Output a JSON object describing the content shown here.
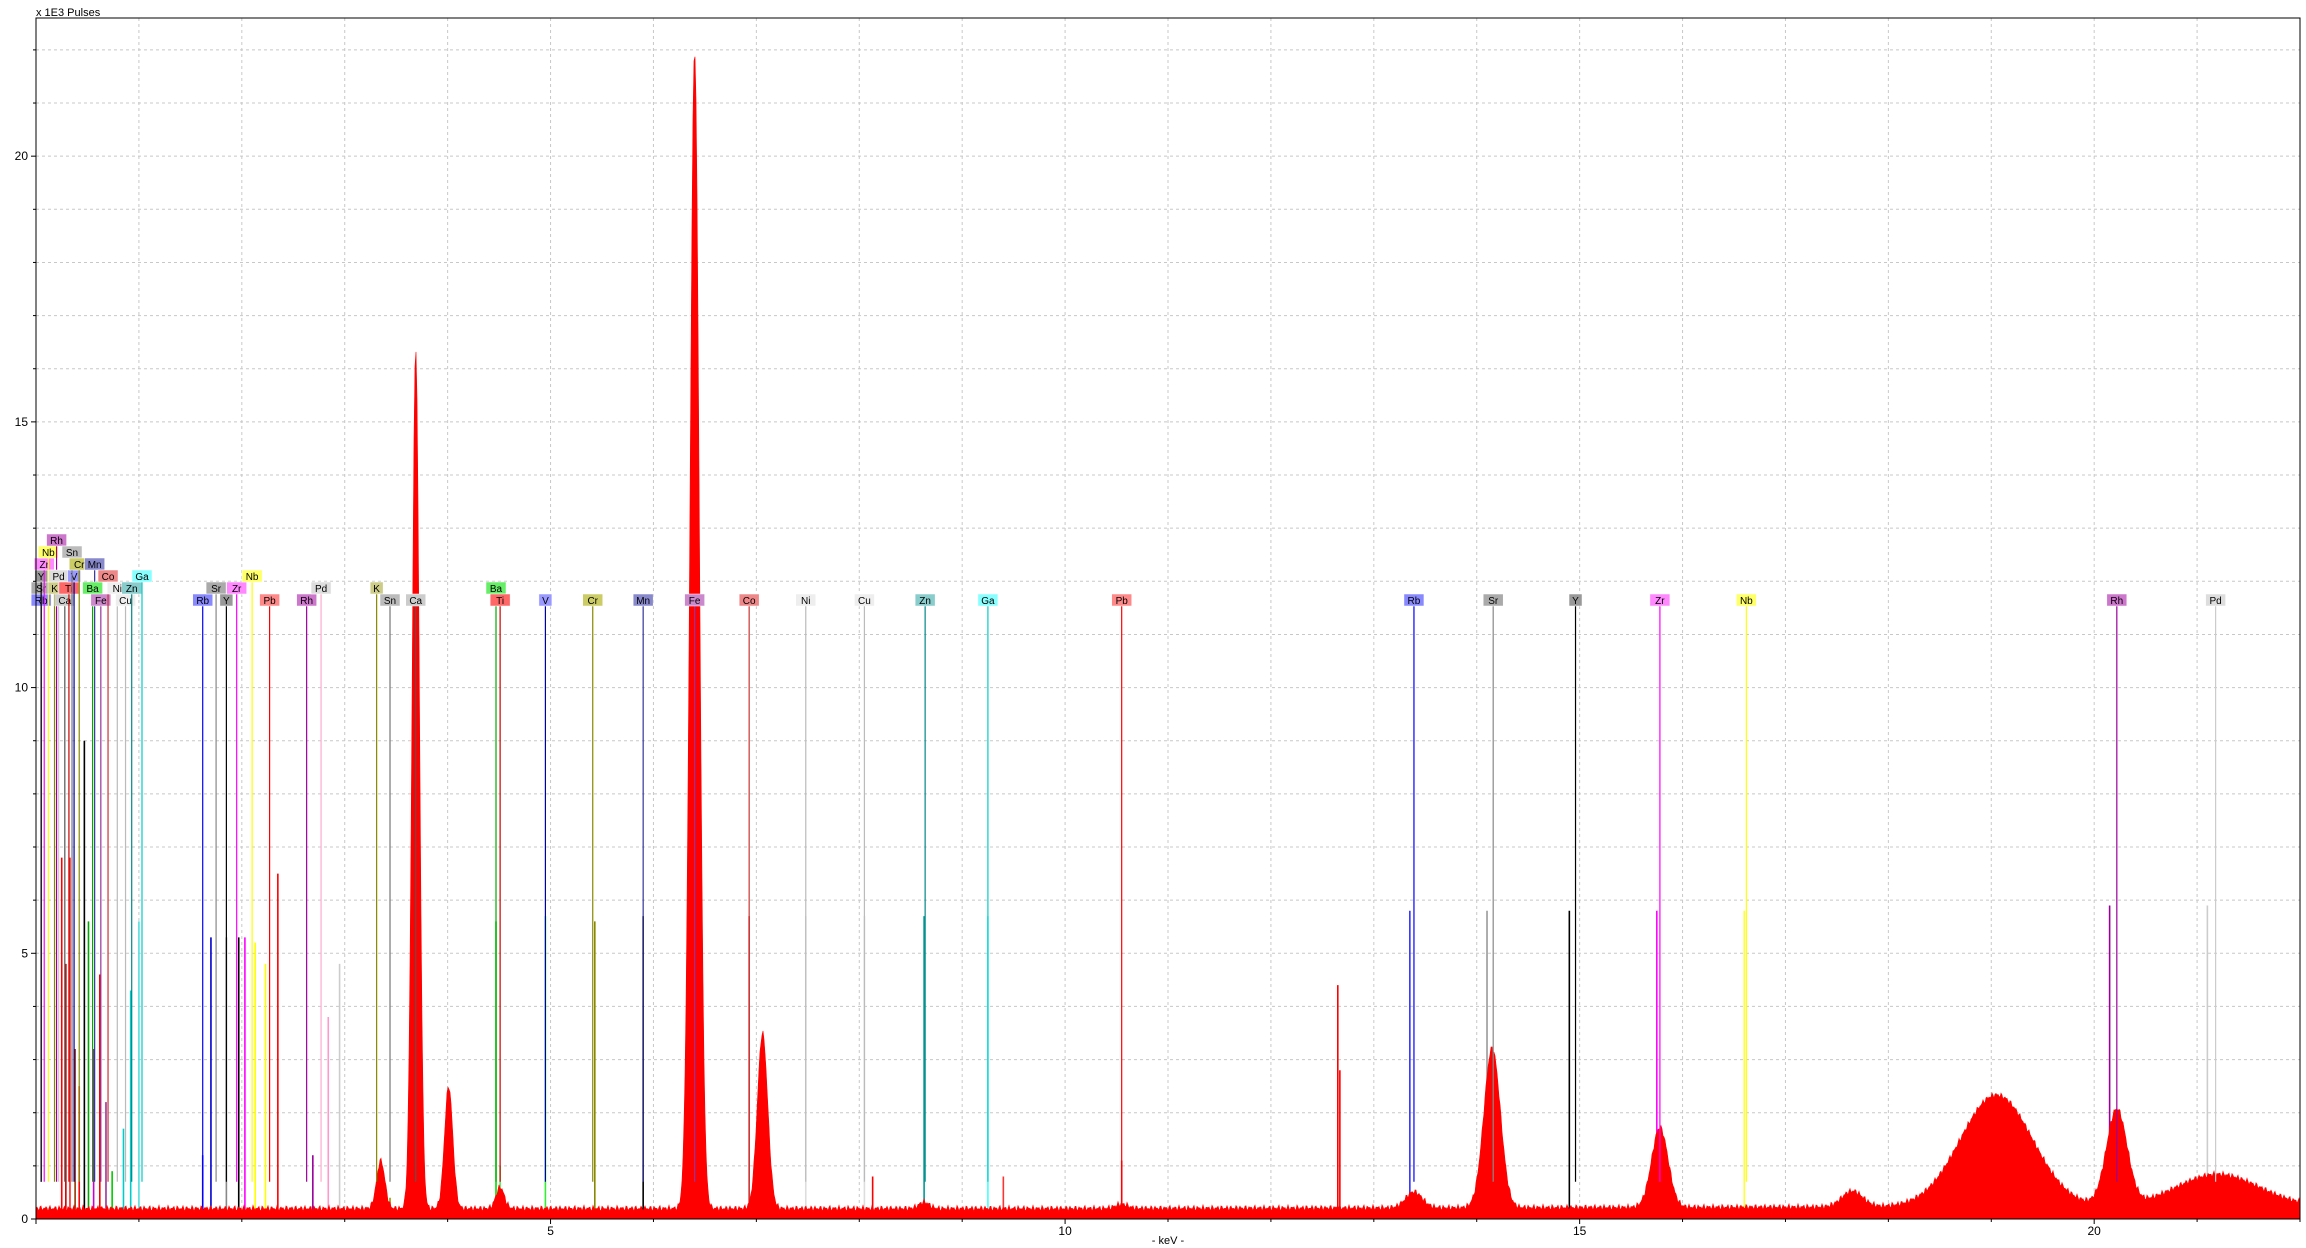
{
  "chart_data": {
    "type": "area",
    "y_unit_label": "x 1E3 Pulses",
    "xlabel": "- keV -",
    "xlim": [
      0,
      22.0
    ],
    "ylim": [
      0,
      22.6
    ],
    "x_ticks": [
      {
        "v": 5,
        "label": "5"
      },
      {
        "v": 10,
        "label": "10"
      },
      {
        "v": 15,
        "label": "15"
      },
      {
        "v": 20,
        "label": "20"
      }
    ],
    "y_ticks": [
      {
        "v": 0,
        "label": "0"
      },
      {
        "v": 5,
        "label": "5"
      },
      {
        "v": 10,
        "label": "10"
      },
      {
        "v": 15,
        "label": "15"
      },
      {
        "v": 20,
        "label": "20"
      }
    ],
    "grid": true,
    "spectrum_color": "#ff0000",
    "background_level": 0.2,
    "peaks": [
      {
        "x": 3.35,
        "h": 0.9,
        "w": 0.04
      },
      {
        "x": 3.69,
        "h": 16.2,
        "w": 0.035
      },
      {
        "x": 4.01,
        "h": 2.3,
        "w": 0.04
      },
      {
        "x": 4.51,
        "h": 0.4,
        "w": 0.04
      },
      {
        "x": 6.4,
        "h": 21.8,
        "w": 0.045
      },
      {
        "x": 7.06,
        "h": 3.3,
        "w": 0.05
      },
      {
        "x": 8.63,
        "h": 0.12,
        "w": 0.05
      },
      {
        "x": 10.55,
        "h": 0.08,
        "w": 0.06
      },
      {
        "x": 13.39,
        "h": 0.3,
        "w": 0.08
      },
      {
        "x": 14.15,
        "h": 3.0,
        "w": 0.08
      },
      {
        "x": 15.78,
        "h": 1.5,
        "w": 0.08
      },
      {
        "x": 17.65,
        "h": 0.3,
        "w": 0.1
      },
      {
        "x": 19.05,
        "h": 2.1,
        "w": 0.35
      },
      {
        "x": 20.22,
        "h": 1.8,
        "w": 0.1
      },
      {
        "x": 21.2,
        "h": 0.6,
        "w": 0.4
      }
    ],
    "spikes": [
      {
        "x": 12.65,
        "v": 4.4,
        "color": "#ff0000"
      },
      {
        "x": 12.67,
        "v": 2.8,
        "color": "#ff0000"
      },
      {
        "x": 8.13,
        "v": 0.8,
        "color": "#ff0000"
      },
      {
        "x": 9.4,
        "v": 0.8,
        "color": "#ff3333"
      },
      {
        "x": 0.25,
        "v": 6.8,
        "color": "#ff0000"
      },
      {
        "x": 0.29,
        "v": 4.8,
        "color": "#cc0000"
      },
      {
        "x": 0.33,
        "v": 6.8,
        "color": "#ff2222"
      },
      {
        "x": 0.38,
        "v": 3.2,
        "color": "#993300"
      },
      {
        "x": 0.42,
        "v": 2.5,
        "color": "#ff0000"
      },
      {
        "x": 0.47,
        "v": 9.0,
        "color": "#000000"
      },
      {
        "x": 0.51,
        "v": 5.6,
        "color": "#00aa00"
      },
      {
        "x": 0.56,
        "v": 3.2,
        "color": "#cc00cc"
      },
      {
        "x": 0.62,
        "v": 4.6,
        "color": "#ff0000"
      },
      {
        "x": 0.68,
        "v": 2.2,
        "color": "#993399"
      },
      {
        "x": 0.74,
        "v": 0.9,
        "color": "#00cc00"
      },
      {
        "x": 0.85,
        "v": 1.7,
        "color": "#00cccc"
      },
      {
        "x": 0.92,
        "v": 4.3,
        "color": "#00cccc"
      },
      {
        "x": 1.0,
        "v": 5.6,
        "color": "#55dddd"
      },
      {
        "x": 1.62,
        "v": 1.2,
        "color": "#0000ff"
      },
      {
        "x": 1.7,
        "v": 5.3,
        "color": "#0000cc"
      },
      {
        "x": 1.85,
        "v": 5.3,
        "color": "#888888"
      },
      {
        "x": 1.97,
        "v": 5.3,
        "color": "#000000"
      },
      {
        "x": 2.03,
        "v": 5.3,
        "color": "#ff00ff"
      },
      {
        "x": 2.13,
        "v": 5.2,
        "color": "#ffff00"
      },
      {
        "x": 2.23,
        "v": 4.8,
        "color": "#ffff00"
      },
      {
        "x": 2.35,
        "v": 6.5,
        "color": "#ff0000"
      },
      {
        "x": 2.69,
        "v": 1.2,
        "color": "#990099"
      },
      {
        "x": 2.84,
        "v": 3.8,
        "color": "#ff99cc"
      },
      {
        "x": 2.95,
        "v": 4.8,
        "color": "#cccccc"
      },
      {
        "x": 3.44,
        "v": 0.4,
        "color": "#999900"
      },
      {
        "x": 3.66,
        "v": 5.6,
        "color": "#ff3333"
      },
      {
        "x": 4.47,
        "v": 5.6,
        "color": "#00dd00"
      },
      {
        "x": 4.51,
        "v": 1.0,
        "color": "#55ee55"
      },
      {
        "x": 4.95,
        "v": 5.7,
        "color": "#33ee33"
      },
      {
        "x": 5.43,
        "v": 5.6,
        "color": "#888800"
      },
      {
        "x": 5.9,
        "v": 5.7,
        "color": "#000000"
      },
      {
        "x": 6.93,
        "v": 5.7,
        "color": "#cc3333"
      },
      {
        "x": 7.48,
        "v": 5.7,
        "color": "#dddddd"
      },
      {
        "x": 8.05,
        "v": 5.7,
        "color": "#dddddd"
      },
      {
        "x": 8.63,
        "v": 5.7,
        "color": "#009999"
      },
      {
        "x": 9.25,
        "v": 5.7,
        "color": "#44ffff"
      },
      {
        "x": 10.55,
        "v": 1.1,
        "color": "#ff0000"
      },
      {
        "x": 13.35,
        "v": 5.8,
        "color": "#3333ff"
      },
      {
        "x": 14.1,
        "v": 5.8,
        "color": "#999999"
      },
      {
        "x": 14.9,
        "v": 5.8,
        "color": "#000000"
      },
      {
        "x": 15.75,
        "v": 5.8,
        "color": "#ff00ff"
      },
      {
        "x": 16.6,
        "v": 5.8,
        "color": "#ffff33"
      },
      {
        "x": 20.15,
        "v": 5.9,
        "color": "#990099"
      },
      {
        "x": 21.1,
        "v": 5.9,
        "color": "#cccccc"
      }
    ],
    "element_markers": [
      {
        "label": "Rb",
        "x": 0.05,
        "row": 0,
        "color": "#8888ff",
        "line": "#0000ff"
      },
      {
        "label": "Sr",
        "x": 0.05,
        "row": 1,
        "color": "#aaaaaa",
        "line": "#888888"
      },
      {
        "label": "Y",
        "x": 0.05,
        "row": 2,
        "color": "#999999",
        "line": "#000000"
      },
      {
        "label": "Zr",
        "x": 0.08,
        "row": 3,
        "color": "#ff88ff",
        "line": "#ff00ff"
      },
      {
        "label": "Nb",
        "x": 0.12,
        "row": 4,
        "color": "#ffff66",
        "line": "#ffff00"
      },
      {
        "label": "Rh",
        "x": 0.2,
        "row": 5,
        "color": "#cc77cc",
        "line": "#990099"
      },
      {
        "label": "K",
        "x": 0.18,
        "row": 1,
        "color": "#cccc88",
        "line": "#888800"
      },
      {
        "label": "Pd",
        "x": 0.22,
        "row": 2,
        "color": "#dddddd",
        "line": "#cccccc"
      },
      {
        "label": "Ca",
        "x": 0.28,
        "row": 0,
        "color": "#cccccc",
        "line": "#555555"
      },
      {
        "label": "Ti",
        "x": 0.32,
        "row": 1,
        "color": "#ff6666",
        "line": "#cc0000"
      },
      {
        "label": "V",
        "x": 0.37,
        "row": 2,
        "color": "#9999ff",
        "line": "#0000aa"
      },
      {
        "label": "Sn",
        "x": 0.35,
        "row": 4,
        "color": "#bbbbbb",
        "line": "#777777"
      },
      {
        "label": "Cr",
        "x": 0.42,
        "row": 3,
        "color": "#cccc66",
        "line": "#888800"
      },
      {
        "label": "Mn",
        "x": 0.57,
        "row": 3,
        "color": "#8888cc",
        "line": "#333399"
      },
      {
        "label": "Ba",
        "x": 0.55,
        "row": 1,
        "color": "#66ee66",
        "line": "#00aa00"
      },
      {
        "label": "Fe",
        "x": 0.63,
        "row": 0,
        "color": "#cc88cc",
        "line": "#993399"
      },
      {
        "label": "Co",
        "x": 0.7,
        "row": 2,
        "color": "#ee8888",
        "line": "#cc3333"
      },
      {
        "label": "Ni",
        "x": 0.79,
        "row": 1,
        "color": "#eeeeee",
        "line": "#bbbbbb"
      },
      {
        "label": "Cu",
        "x": 0.87,
        "row": 0,
        "color": "#eeeeee",
        "line": "#bbbbbb"
      },
      {
        "label": "Zn",
        "x": 0.93,
        "row": 1,
        "color": "#88cccc",
        "line": "#008888"
      },
      {
        "label": "Ga",
        "x": 1.03,
        "row": 2,
        "color": "#88ffff",
        "line": "#00cccc"
      },
      {
        "label": "Rb",
        "x": 1.62,
        "row": 0,
        "color": "#8888ff",
        "line": "#0000ff"
      },
      {
        "label": "Sr",
        "x": 1.75,
        "row": 1,
        "color": "#aaaaaa",
        "line": "#888888"
      },
      {
        "label": "Y",
        "x": 1.85,
        "row": 0,
        "color": "#999999",
        "line": "#000000"
      },
      {
        "label": "Zr",
        "x": 1.95,
        "row": 1,
        "color": "#ff88ff",
        "line": "#ff00ff"
      },
      {
        "label": "Nb",
        "x": 2.1,
        "row": 2,
        "color": "#ffff66",
        "line": "#ffff00"
      },
      {
        "label": "Pb",
        "x": 2.27,
        "row": 0,
        "color": "#ff8888",
        "line": "#ff0000"
      },
      {
        "label": "Rh",
        "x": 2.63,
        "row": 0,
        "color": "#cc77cc",
        "line": "#990099"
      },
      {
        "label": "Pd",
        "x": 2.77,
        "row": 1,
        "color": "#dddddd",
        "line": "#ffaacc"
      },
      {
        "label": "K",
        "x": 3.31,
        "row": 1,
        "color": "#cccc88",
        "line": "#888800"
      },
      {
        "label": "Sn",
        "x": 3.44,
        "row": 0,
        "color": "#bbbbbb",
        "line": "#777777"
      },
      {
        "label": "Ca",
        "x": 3.69,
        "row": 0,
        "color": "#cccccc",
        "line": "#555555"
      },
      {
        "label": "Ba",
        "x": 4.47,
        "row": 1,
        "color": "#66ee66",
        "line": "#00aa00"
      },
      {
        "label": "Ti",
        "x": 4.51,
        "row": 0,
        "color": "#ff6666",
        "line": "#cc0000"
      },
      {
        "label": "V",
        "x": 4.95,
        "row": 0,
        "color": "#9999ff",
        "line": "#0000aa"
      },
      {
        "label": "Cr",
        "x": 5.41,
        "row": 0,
        "color": "#cccc66",
        "line": "#888800"
      },
      {
        "label": "Mn",
        "x": 5.9,
        "row": 0,
        "color": "#8888cc",
        "line": "#333399"
      },
      {
        "label": "Fe",
        "x": 6.4,
        "row": 0,
        "color": "#cc88cc",
        "line": "#993399"
      },
      {
        "label": "Co",
        "x": 6.93,
        "row": 0,
        "color": "#ee8888",
        "line": "#cc3333"
      },
      {
        "label": "Ni",
        "x": 7.48,
        "row": 0,
        "color": "#eeeeee",
        "line": "#bbbbbb"
      },
      {
        "label": "Cu",
        "x": 8.05,
        "row": 0,
        "color": "#eeeeee",
        "line": "#bbbbbb"
      },
      {
        "label": "Zn",
        "x": 8.64,
        "row": 0,
        "color": "#88cccc",
        "line": "#008888"
      },
      {
        "label": "Ga",
        "x": 9.25,
        "row": 0,
        "color": "#88ffff",
        "line": "#00cccc"
      },
      {
        "label": "Pb",
        "x": 10.55,
        "row": 0,
        "color": "#ff8888",
        "line": "#ff0000"
      },
      {
        "label": "Rb",
        "x": 13.39,
        "row": 0,
        "color": "#8888ff",
        "line": "#0000ff"
      },
      {
        "label": "Sr",
        "x": 14.16,
        "row": 0,
        "color": "#aaaaaa",
        "line": "#888888"
      },
      {
        "label": "Y",
        "x": 14.96,
        "row": 0,
        "color": "#999999",
        "line": "#000000"
      },
      {
        "label": "Zr",
        "x": 15.78,
        "row": 0,
        "color": "#ff88ff",
        "line": "#ff00ff"
      },
      {
        "label": "Nb",
        "x": 16.62,
        "row": 0,
        "color": "#ffff66",
        "line": "#ffff00"
      },
      {
        "label": "Rh",
        "x": 20.22,
        "row": 0,
        "color": "#cc77cc",
        "line": "#990099"
      },
      {
        "label": "Pd",
        "x": 21.18,
        "row": 0,
        "color": "#dddddd",
        "line": "#cccccc"
      }
    ]
  }
}
